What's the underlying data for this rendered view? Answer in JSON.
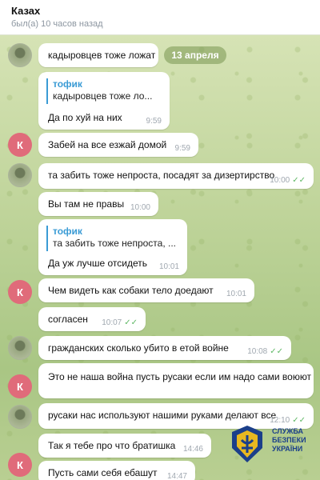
{
  "header": {
    "title": "Казах",
    "status": "был(а) 10 часов назад"
  },
  "date_pill": "13 апреля",
  "avatars": {
    "k_letter": "К"
  },
  "messages": [
    {
      "text": "кадыровцев тоже ложат"
    },
    {
      "reply_name": "тофик",
      "reply_text": "кадыровцев тоже ло...",
      "text": "Да по хуй на них",
      "time": "9:59"
    },
    {
      "text": "Забей на все езжай домой",
      "time": "9:59"
    },
    {
      "text": "та забить тоже непроста, посадят за дизертирство",
      "time": "10:00"
    },
    {
      "text": "Вы там не правы",
      "time": "10:00"
    },
    {
      "reply_name": "тофик",
      "reply_text": "та забить тоже непроста, ...",
      "text": "Да уж лучше отсидеть",
      "time": "10:01"
    },
    {
      "text": "Чем видеть как собаки тело доедают",
      "time": "10:01"
    },
    {
      "text": "согласен",
      "time": "10:07"
    },
    {
      "text": "гражданских сколько убито в етой войне",
      "time": "10:08"
    },
    {
      "text": "Это не наша война пусть русаки если им надо сами воюют"
    },
    {
      "text": "русаки нас используют нашими руками делают все",
      "time": "12:10"
    },
    {
      "text": "Так я тебе про что братишка",
      "time": "14:46"
    },
    {
      "text": "Пусть сами себя ебашут",
      "time": "14:47"
    }
  ],
  "watermark": {
    "line1": "СЛУЖБА",
    "line2": "БЕЗПЕКИ",
    "line3": "УКРАЇНИ"
  },
  "colors": {
    "accent_blue": "#3a9bd5",
    "read_tick_green": "#5fb865",
    "avatar_pink": "#e06b7a",
    "sbu_blue": "#1b3f8a",
    "sbu_gold": "#e8b820"
  },
  "icons": [
    "double-check-icon",
    "sbu-emblem-icon"
  ]
}
